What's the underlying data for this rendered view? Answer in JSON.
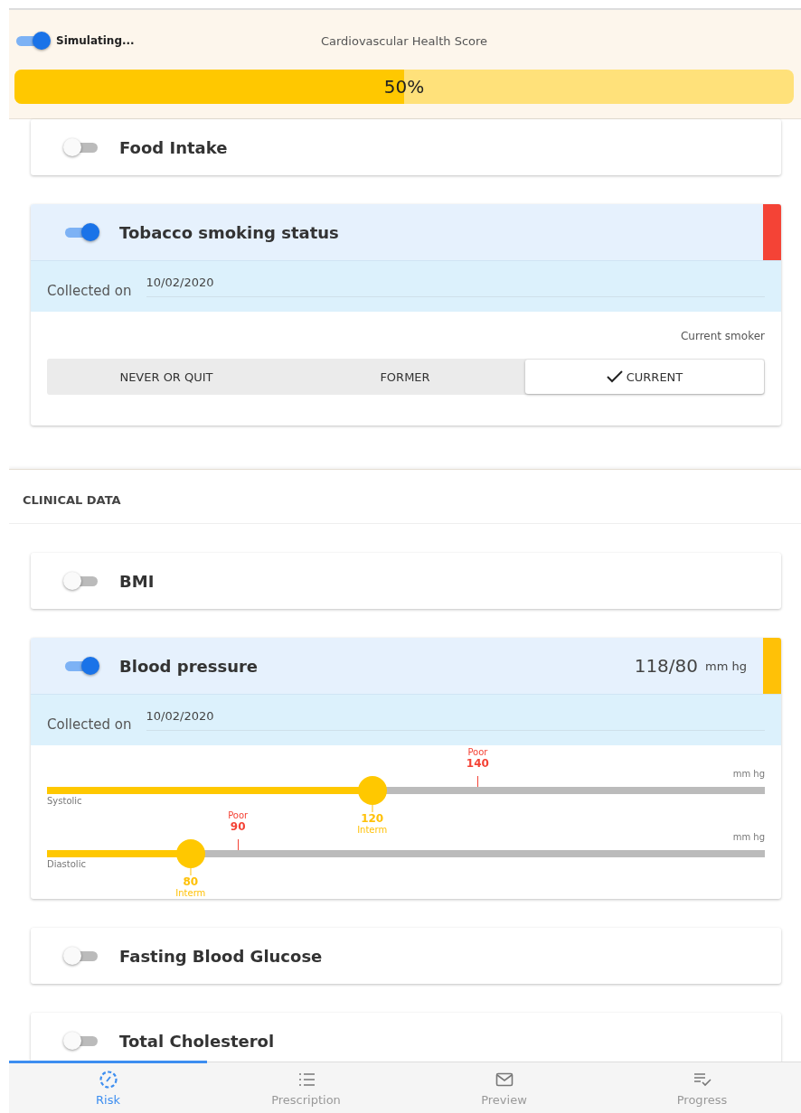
{
  "header": {
    "simulating": {
      "label": "Simulating...",
      "on": true
    },
    "title": "Cardiovascular Health Score",
    "score": {
      "label": "50%",
      "level": 0.5
    }
  },
  "sections": [
    {
      "cards": [
        {
          "kind": "toggle",
          "title": "Food Intake",
          "on": false
        },
        {
          "kind": "choice",
          "title": "Tobacco smoking status",
          "on": true,
          "color": "#f44336",
          "collected_label": "Collected on",
          "collected_date": "10/02/2020",
          "result": "Current smoker",
          "options": [
            {
              "label": "NEVER OR QUIT",
              "selected": false
            },
            {
              "label": "FORMER",
              "selected": false
            },
            {
              "label": "CURRENT",
              "selected": true
            }
          ]
        }
      ]
    },
    {
      "title": "CLINICAL DATA",
      "cards": [
        {
          "kind": "toggle",
          "title": "BMI",
          "on": false
        },
        {
          "kind": "sliders",
          "title": "Blood pressure",
          "on": true,
          "color": "#ffc107",
          "reading": "118/80",
          "unit": "mm hg",
          "collected_label": "Collected on",
          "collected_date": "10/02/2020",
          "sliders": [
            {
              "name": "Systolic",
              "unit": "mm hg",
              "value": "120",
              "status": "Interm",
              "level": 0.453,
              "threshold": {
                "label": "Poor",
                "value": "140",
                "level": 0.6
              }
            },
            {
              "name": "Diastolic",
              "unit": "mm hg",
              "value": "80",
              "status": "Interm",
              "level": 0.2,
              "threshold": {
                "label": "Poor",
                "value": "90",
                "level": 0.266
              }
            }
          ]
        },
        {
          "kind": "toggle",
          "title": "Fasting Blood Glucose",
          "on": false
        },
        {
          "kind": "toggle",
          "title": "Total Cholesterol",
          "on": false
        }
      ]
    }
  ],
  "nav": [
    {
      "label": "Risk",
      "selected": true
    },
    {
      "label": "Prescription",
      "selected": false
    },
    {
      "label": "Preview",
      "selected": false
    },
    {
      "label": "Progress",
      "selected": false
    }
  ]
}
